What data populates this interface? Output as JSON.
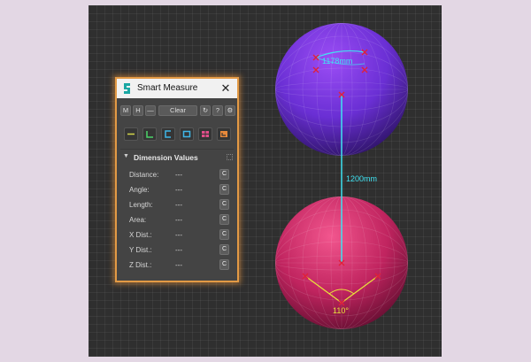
{
  "panel": {
    "title": "Smart Measure",
    "close_glyph": "✕",
    "toolbar": {
      "m_label": "M",
      "h_label": "H",
      "dash_label": "—",
      "clear_label": "Clear",
      "refresh_glyph": "↻",
      "help_label": "?",
      "settings_glyph": "⚙"
    },
    "tools": [
      {
        "icon": "line-tool-icon",
        "color": "#d4d64a"
      },
      {
        "icon": "angle-tool-icon",
        "color": "#4cd46a"
      },
      {
        "icon": "bracket-tool-icon",
        "color": "#3fb7e8"
      },
      {
        "icon": "rectangle-tool-icon",
        "color": "#3fb7e8"
      },
      {
        "icon": "grid-tool-icon",
        "color": "#e14e8a"
      },
      {
        "icon": "corner-tool-icon",
        "color": "#e8893a"
      }
    ],
    "section_title": "Dimension Values",
    "section_arrow": "▼",
    "copy_label": "C",
    "rows": [
      {
        "label": "Distance:",
        "value": "---"
      },
      {
        "label": "Angle:",
        "value": "---"
      },
      {
        "label": "Length:",
        "value": "---"
      },
      {
        "label": "Area:",
        "value": "---"
      },
      {
        "label": "X Dist.:",
        "value": "---"
      },
      {
        "label": "Y Dist.:",
        "value": "---"
      },
      {
        "label": "Z Dist.:",
        "value": "---"
      }
    ]
  },
  "viewport": {
    "distance_label": "1200mm",
    "angle_label": "110°",
    "top_sphere_label": "1178mm",
    "measure_line_color": "#3fe3f2",
    "angle_color": "#e8e33a",
    "marker_color": "#e0203a"
  }
}
